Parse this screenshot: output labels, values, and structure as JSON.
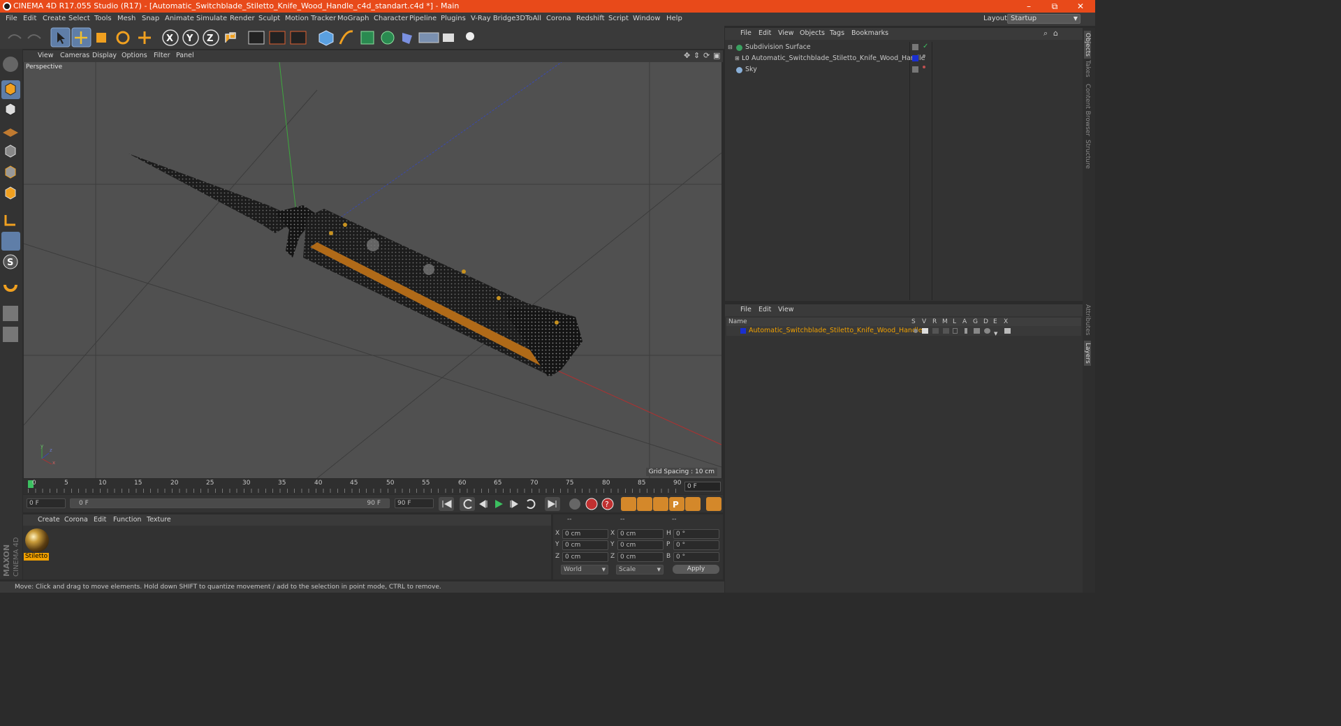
{
  "window": {
    "title": "CINEMA 4D R17.055 Studio (R17) - [Automatic_Switchblade_Stiletto_Knife_Wood_Handle_c4d_standart.c4d *] - Main",
    "minimize": "–",
    "maximize": "⧉",
    "close": "✕"
  },
  "menubar": {
    "items": [
      "File",
      "Edit",
      "Create",
      "Select",
      "Tools",
      "Mesh",
      "Snap",
      "Animate",
      "Simulate",
      "Render",
      "Sculpt",
      "Motion Tracker",
      "MoGraph",
      "Character",
      "Pipeline",
      "Plugins",
      "V-Ray Bridge",
      "3DToAll",
      "Corona",
      "Redshift",
      "Script",
      "Window",
      "Help"
    ],
    "layout_label": "Layout:",
    "layout_value": "Startup"
  },
  "viewport": {
    "menu": [
      "View",
      "Cameras",
      "Display",
      "Options",
      "Filter",
      "Panel"
    ],
    "label": "Perspective",
    "grid_spacing": "Grid Spacing : 10 cm",
    "axis_y": "y",
    "axis_z": "z",
    "axis_x": "x"
  },
  "timeline": {
    "ticks": [
      "0",
      "5",
      "10",
      "15",
      "20",
      "25",
      "30",
      "35",
      "40",
      "45",
      "50",
      "55",
      "60",
      "65",
      "70",
      "75",
      "80",
      "85",
      "90"
    ],
    "current_frame": "0 F",
    "start_field": "0 F",
    "range_start": "0 F",
    "range_end": "90 F",
    "end_field": "90 F"
  },
  "material_manager": {
    "menu": [
      "Create",
      "Corona",
      "Edit",
      "Function",
      "Texture"
    ],
    "materials": [
      {
        "name": "Stiletto"
      }
    ]
  },
  "coordinates": {
    "header": [
      "--",
      "--",
      "--"
    ],
    "rows": [
      {
        "a": "X",
        "av": "0 cm",
        "b": "X",
        "bv": "0 cm",
        "c": "H",
        "cv": "0 °"
      },
      {
        "a": "Y",
        "av": "0 cm",
        "b": "Y",
        "bv": "0 cm",
        "c": "P",
        "cv": "0 °"
      },
      {
        "a": "Z",
        "av": "0 cm",
        "b": "Z",
        "bv": "0 cm",
        "c": "B",
        "cv": "0 °"
      }
    ],
    "mode1": "World",
    "mode2": "Scale",
    "apply": "Apply"
  },
  "status": "Move: Click and drag to move elements. Hold down SHIFT to quantize movement / add to the selection in point mode, CTRL to remove.",
  "object_manager": {
    "menu": [
      "File",
      "Edit",
      "View",
      "Objects",
      "Tags",
      "Bookmarks"
    ],
    "objects": [
      {
        "name": "Subdivision Surface"
      },
      {
        "name": "Automatic_Switchblade_Stiletto_Knife_Wood_Handle"
      },
      {
        "name": "Sky"
      }
    ]
  },
  "layer_manager": {
    "menu": [
      "File",
      "Edit",
      "View"
    ],
    "header_name": "Name",
    "columns": [
      "S",
      "V",
      "R",
      "M",
      "L",
      "A",
      "G",
      "D",
      "E",
      "X"
    ],
    "layers": [
      {
        "name": "Automatic_Switchblade_Stiletto_Knife_Wood_Handle",
        "color": "#1a2fd0"
      }
    ]
  },
  "right_tabs": [
    "Objects",
    "Takes",
    "Content Browser",
    "Structure",
    "Attributes",
    "Layers"
  ],
  "colors": {
    "accent": "#e84a1a",
    "selection": "#5f7ea8",
    "material_tag": "#f0a000"
  }
}
